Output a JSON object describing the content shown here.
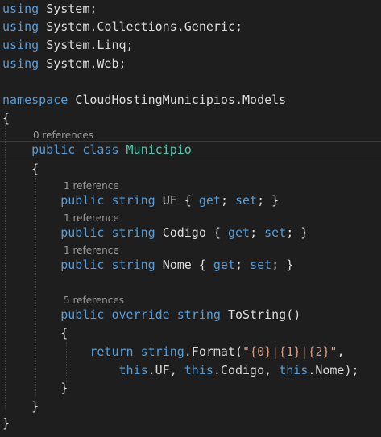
{
  "colors": {
    "background": "#1e1e1e",
    "keyword": "#569cd6",
    "type": "#4ec9b0",
    "string": "#d69d85",
    "text": "#dcdcdc",
    "codelens": "#999999"
  },
  "code": {
    "using": "using",
    "ns_system": "System;",
    "ns_generic": "System.Collections.Generic;",
    "ns_linq": "System.Linq;",
    "ns_web": "System.Web;",
    "namespace_kw": "namespace",
    "namespace_name": "CloudHostingMunicipios.Models",
    "open_brace": "{",
    "close_brace": "}",
    "public": "public",
    "class": "class",
    "class_name": "Municipio",
    "string_kw": "string",
    "prop_uf": "UF",
    "prop_codigo": "Codigo",
    "prop_nome": "Nome",
    "get": "get",
    "set": "set",
    "accessor_open": "{ ",
    "accessor_sep": "; ",
    "accessor_close": "; }",
    "override": "override",
    "method_name": "ToString()",
    "return": "return",
    "format_call": ".Format(",
    "format_string": "\"{0}|{1}|{2}\"",
    "comma": ",",
    "this": "this",
    "arg_uf": ".UF, ",
    "arg_codigo": ".Codigo, ",
    "arg_nome": ".Nome);"
  },
  "codelens": {
    "class_refs": "0 references",
    "uf_refs": "1 reference",
    "codigo_refs": "1 reference",
    "nome_refs": "1 reference",
    "tostring_refs": "5 references"
  }
}
